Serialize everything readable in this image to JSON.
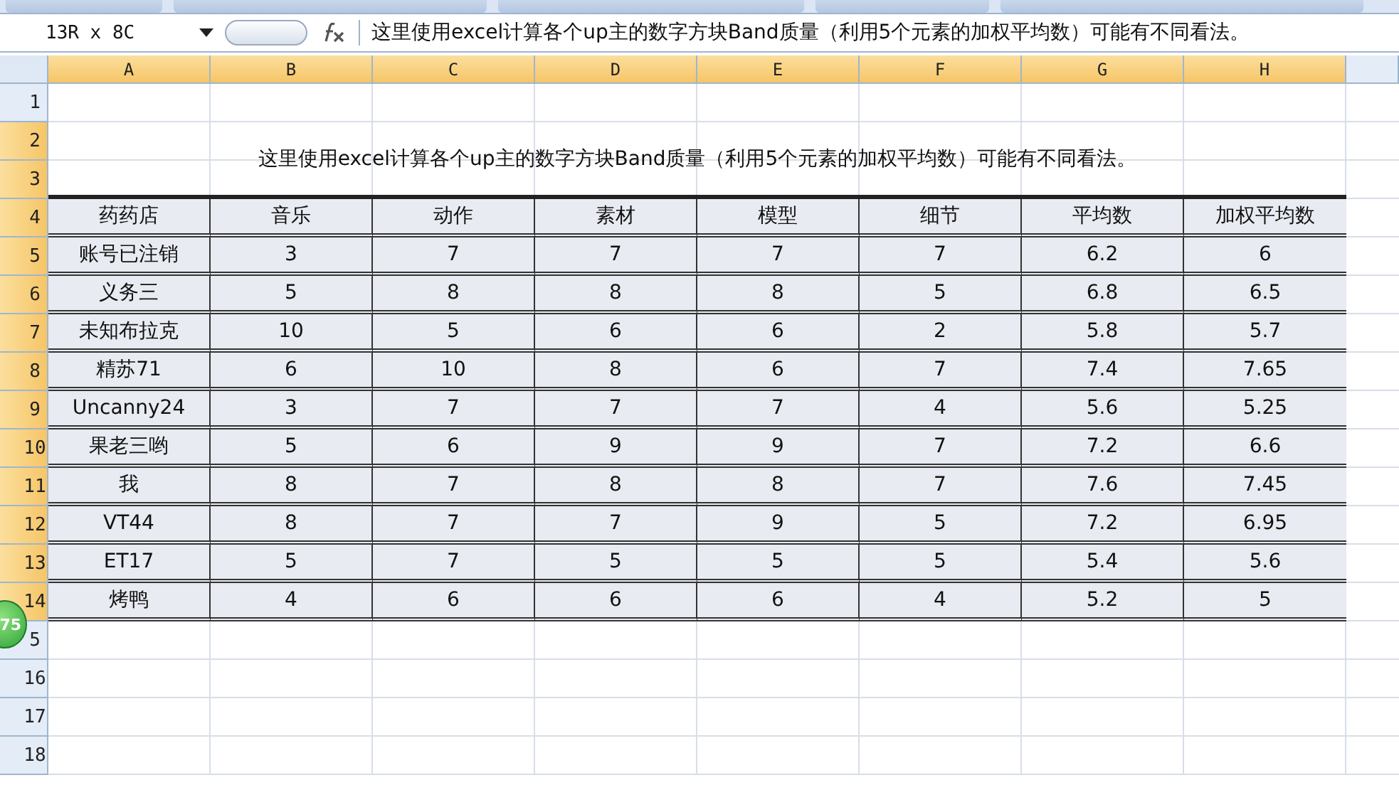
{
  "formula_bar": {
    "name_box": "13R x 8C",
    "formula": "这里使用excel计算各个up主的数字方块Band质量（利用5个元素的加权平均数）可能有不同看法。"
  },
  "column_headers": [
    {
      "label": "A",
      "selected": true
    },
    {
      "label": "B",
      "selected": true
    },
    {
      "label": "C",
      "selected": true
    },
    {
      "label": "D",
      "selected": true
    },
    {
      "label": "E",
      "selected": true
    },
    {
      "label": "F",
      "selected": true
    },
    {
      "label": "G",
      "selected": true
    },
    {
      "label": "H",
      "selected": true
    }
  ],
  "row_headers": [
    {
      "label": "1",
      "selected": false
    },
    {
      "label": "2",
      "selected": true
    },
    {
      "label": "3",
      "selected": true
    },
    {
      "label": "4",
      "selected": true
    },
    {
      "label": "5",
      "selected": true
    },
    {
      "label": "6",
      "selected": true
    },
    {
      "label": "7",
      "selected": true
    },
    {
      "label": "8",
      "selected": true
    },
    {
      "label": "9",
      "selected": true
    },
    {
      "label": "10",
      "selected": true
    },
    {
      "label": "11",
      "selected": true
    },
    {
      "label": "12",
      "selected": true
    },
    {
      "label": "13",
      "selected": true
    },
    {
      "label": "14",
      "selected": true
    },
    {
      "label": "5",
      "selected": false
    },
    {
      "label": "16",
      "selected": false
    },
    {
      "label": "17",
      "selected": false
    },
    {
      "label": "18",
      "selected": false
    }
  ],
  "title": "这里使用excel计算各个up主的数字方块Band质量（利用5个元素的加权平均数）可能有不同看法。",
  "table": {
    "columns": [
      "药药店",
      "音乐",
      "动作",
      "素材",
      "模型",
      "细节",
      "平均数",
      "加权平均数"
    ],
    "rows": [
      [
        "账号已注销",
        "3",
        "7",
        "7",
        "7",
        "7",
        "6.2",
        "6"
      ],
      [
        "义务三",
        "5",
        "8",
        "8",
        "8",
        "5",
        "6.8",
        "6.5"
      ],
      [
        "未知布拉克",
        "10",
        "5",
        "6",
        "6",
        "2",
        "5.8",
        "5.7"
      ],
      [
        "精苏71",
        "6",
        "10",
        "8",
        "6",
        "7",
        "7.4",
        "7.65"
      ],
      [
        "Uncanny24",
        "3",
        "7",
        "7",
        "7",
        "4",
        "5.6",
        "5.25"
      ],
      [
        "果老三哟",
        "5",
        "6",
        "9",
        "9",
        "7",
        "7.2",
        "6.6"
      ],
      [
        "我",
        "8",
        "7",
        "8",
        "8",
        "7",
        "7.6",
        "7.45"
      ],
      [
        "VT44",
        "8",
        "7",
        "7",
        "9",
        "5",
        "7.2",
        "6.95"
      ],
      [
        "ET17",
        "5",
        "7",
        "5",
        "5",
        "5",
        "5.4",
        "5.6"
      ],
      [
        "烤鸭",
        "4",
        "6",
        "6",
        "6",
        "4",
        "5.2",
        "5"
      ]
    ]
  },
  "badge": "75"
}
